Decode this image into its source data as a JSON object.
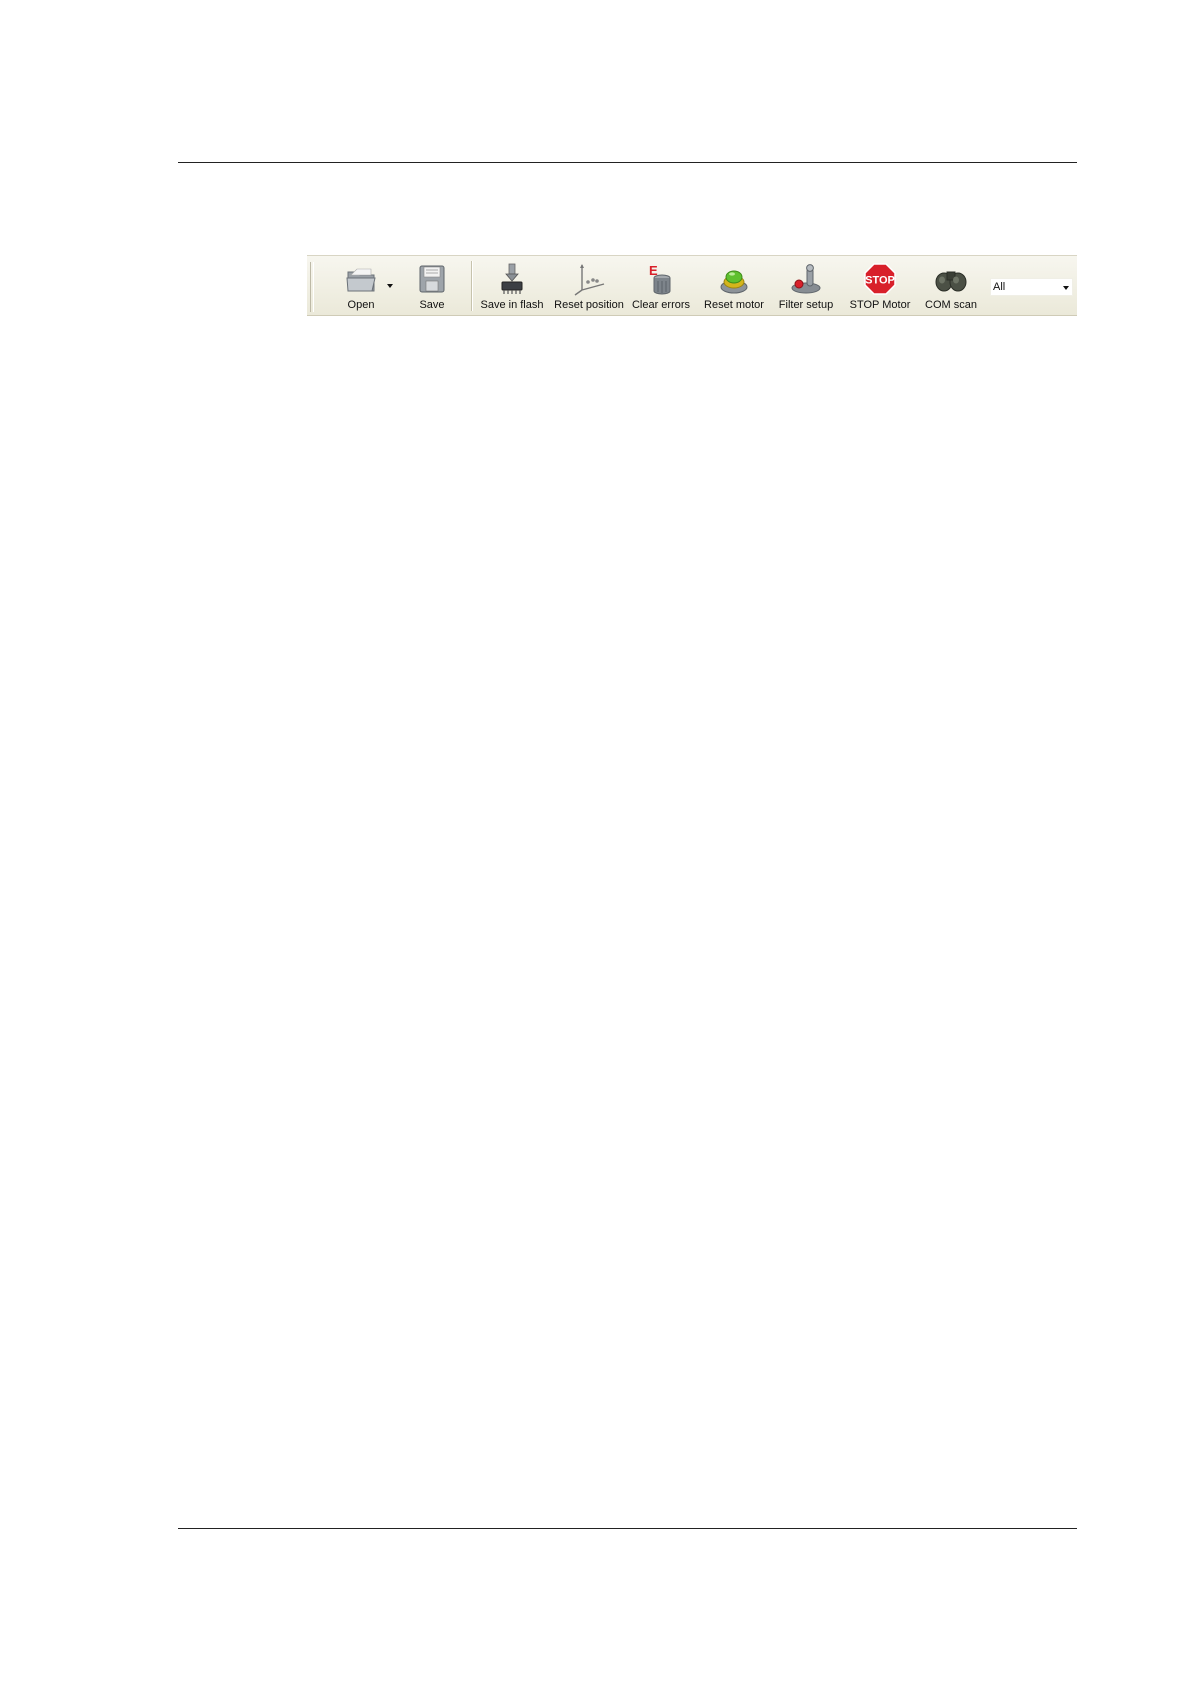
{
  "toolbar": {
    "buttons": [
      {
        "label": "Open",
        "icon": "folder-icon"
      },
      {
        "label": "Save",
        "icon": "floppy-disk-icon"
      },
      {
        "label": "Save in flash",
        "icon": "chip-download-icon"
      },
      {
        "label": "Reset position",
        "icon": "axes-icon"
      },
      {
        "label": "Clear errors",
        "icon": "error-bin-icon"
      },
      {
        "label": "Reset motor",
        "icon": "green-button-icon"
      },
      {
        "label": "Filter setup",
        "icon": "joystick-icon"
      },
      {
        "label": "STOP Motor",
        "icon": "stop-sign-icon"
      },
      {
        "label": "COM scan",
        "icon": "binoculars-icon"
      }
    ],
    "stop_sign_text": "STOP",
    "combo": {
      "value": "All"
    }
  },
  "colors": {
    "toolbar_bg": "#ece9d8",
    "stop_red": "#d8202a",
    "rule": "#222222"
  }
}
